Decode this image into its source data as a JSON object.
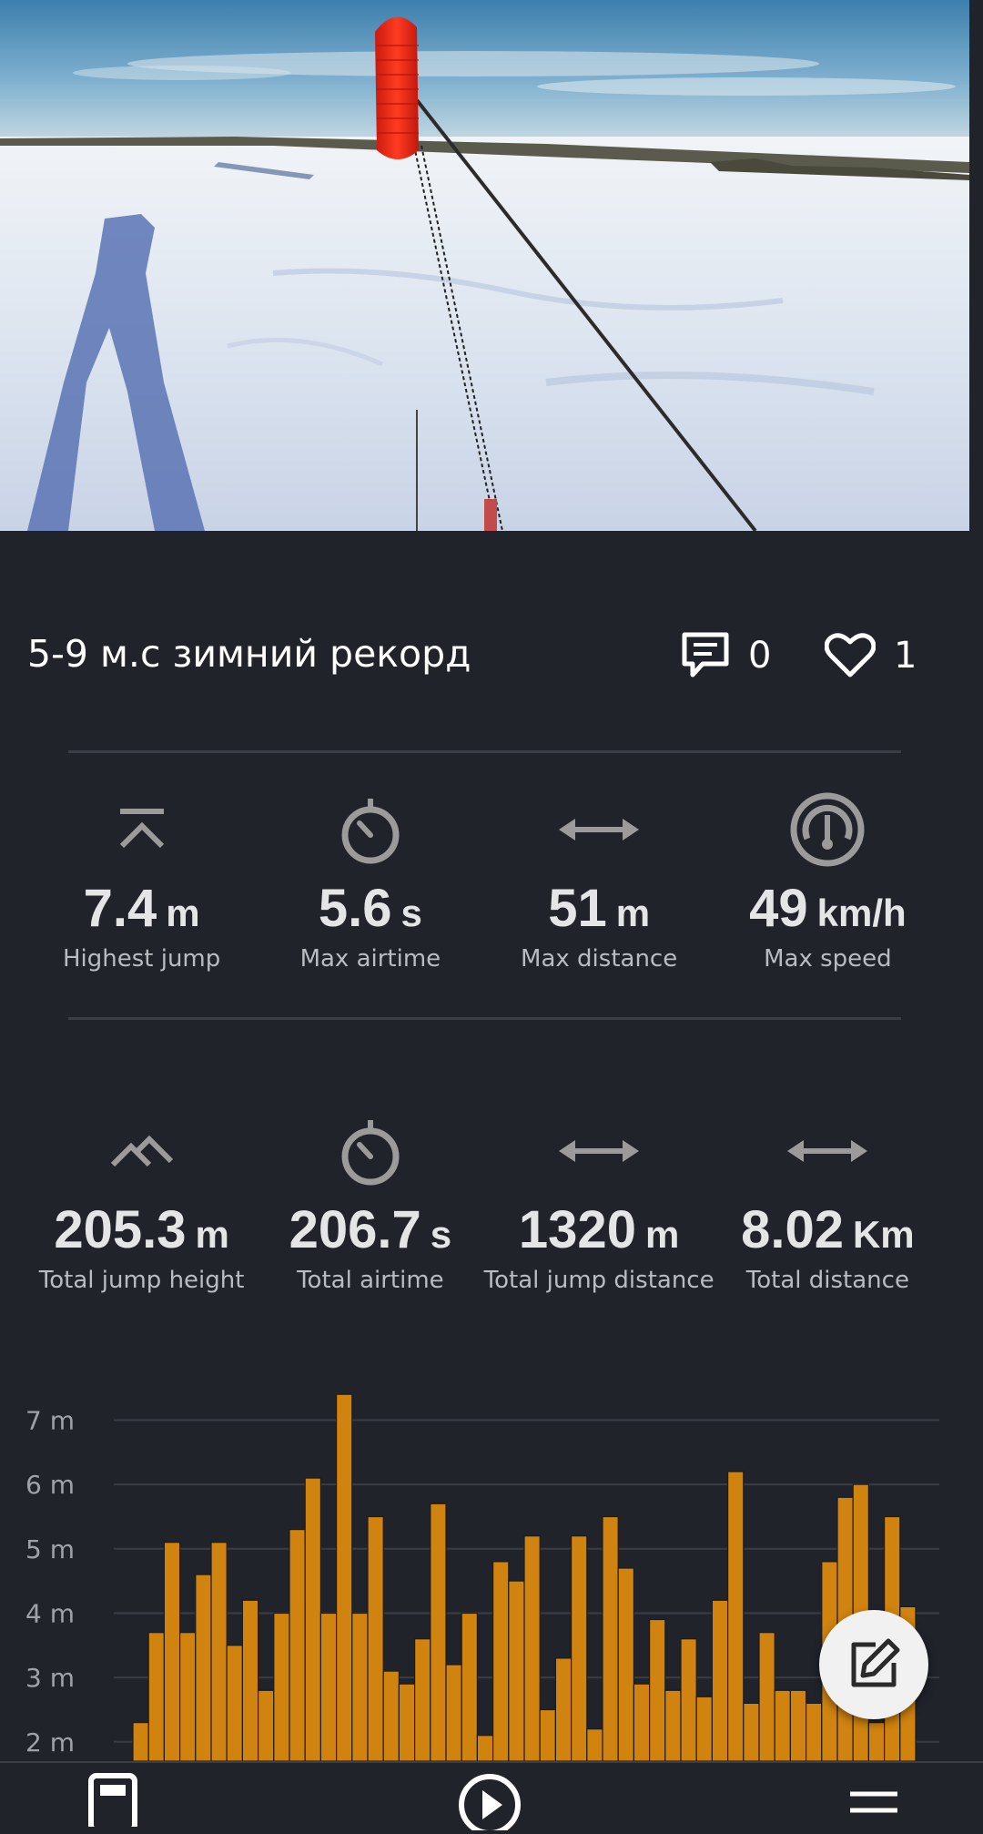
{
  "session": {
    "title": "5-9 м.с зимний рекорд",
    "comments_count": "0",
    "likes_count": "1"
  },
  "records": [
    {
      "icon": "highest-jump-icon",
      "value": "7.4",
      "unit": "m",
      "label": "Highest jump"
    },
    {
      "icon": "stopwatch-icon",
      "value": "5.6",
      "unit": "s",
      "label": "Max airtime"
    },
    {
      "icon": "horizontal-arrows-icon",
      "value": "51",
      "unit": "m",
      "label": "Max distance"
    },
    {
      "icon": "speedometer-icon",
      "value": "49",
      "unit": "km/h",
      "label": "Max speed"
    }
  ],
  "totals": [
    {
      "icon": "total-jump-icon",
      "value": "205.3",
      "unit": "m",
      "label": "Total jump height"
    },
    {
      "icon": "stopwatch-icon",
      "value": "206.7",
      "unit": "s",
      "label": "Total airtime"
    },
    {
      "icon": "horizontal-arrows-icon",
      "value": "1320",
      "unit": "m",
      "label": "Total jump distance"
    },
    {
      "icon": "horizontal-arrows-icon",
      "value": "8.02",
      "unit": "Km",
      "label": "Total distance"
    }
  ],
  "colors": {
    "background": "#20232a",
    "bar": "#d0830f",
    "bar_stroke": "#1c1c1c",
    "text": "#e4e5e7",
    "muted_text": "#b9bcc1",
    "icon": "#9b9b9b"
  },
  "chart_data": {
    "type": "bar",
    "ylabel": "",
    "xlabel": "",
    "ylim": [
      1.7,
      7.7
    ],
    "y_ticks": [
      2,
      3,
      4,
      5,
      6,
      7
    ],
    "y_tick_labels": [
      "2 m",
      "3 m",
      "4 m",
      "5 m",
      "6 m",
      "7 m"
    ],
    "grid": true,
    "values": [
      2.3,
      3.7,
      5.1,
      3.7,
      4.6,
      5.1,
      3.5,
      4.2,
      2.8,
      4.0,
      5.3,
      6.1,
      4.0,
      7.4,
      4.0,
      5.5,
      3.1,
      2.9,
      3.6,
      5.7,
      3.2,
      4.0,
      2.1,
      4.8,
      4.5,
      5.2,
      2.5,
      3.3,
      5.2,
      2.2,
      5.5,
      4.7,
      2.9,
      3.9,
      2.8,
      3.6,
      2.7,
      4.2,
      6.2,
      2.6,
      3.7,
      2.8,
      2.8,
      2.6,
      4.8,
      5.8,
      6.0,
      2.3,
      5.5,
      4.1
    ]
  },
  "fab": {
    "icon": "edit-icon"
  },
  "bottom_nav": [
    {
      "icon": "journal-icon"
    },
    {
      "icon": "play-circle-icon"
    },
    {
      "icon": "menu-icon"
    }
  ]
}
